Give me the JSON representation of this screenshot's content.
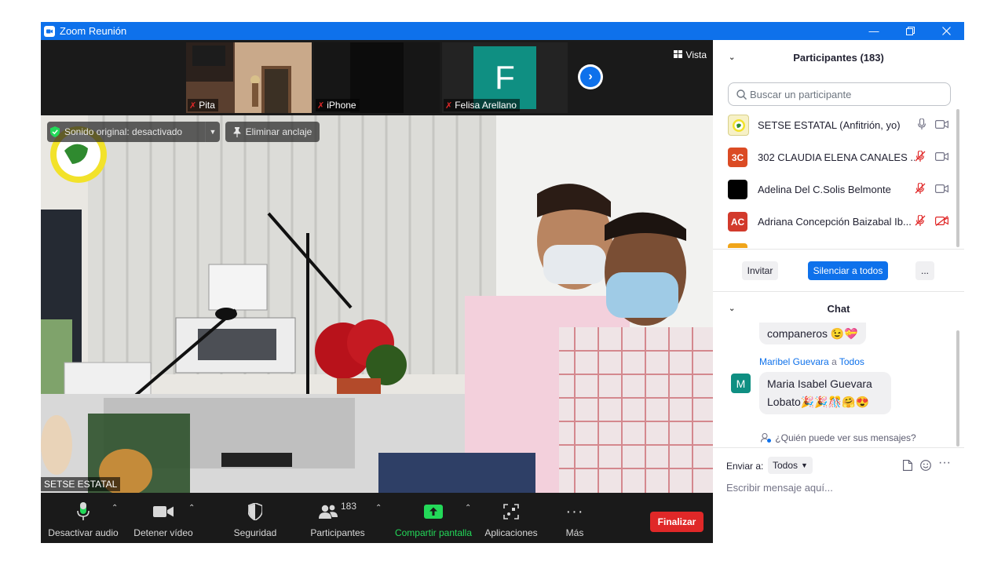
{
  "window": {
    "title": "Zoom Reunión"
  },
  "strip": {
    "tiles": [
      {
        "name": "Pita"
      },
      {
        "name": "iPhone"
      },
      {
        "name": "Felisa Arellano",
        "initial": "F"
      }
    ],
    "view_label": "Vista"
  },
  "main_video": {
    "original_sound": "Sonido original: desactivado",
    "unpin": "Eliminar anclaje",
    "speaker": "SETSE ESTATAL"
  },
  "toolbar": {
    "mute": "Desactivar audio",
    "video": "Detener vídeo",
    "security": "Seguridad",
    "participants": "Participantes",
    "participants_count": "183",
    "share": "Compartir pantalla",
    "apps": "Aplicaciones",
    "more": "Más",
    "end": "Finalizar"
  },
  "participants": {
    "title": "Participantes (183)",
    "search_placeholder": "Buscar un participante",
    "list": [
      {
        "name": "SETSE ESTATAL (Anfitrión, yo)",
        "initials": ""
      },
      {
        "name": "302 CLAUDIA ELENA CANALES ...",
        "initials": "3C"
      },
      {
        "name": "Adelina Del C.Solis Belmonte",
        "initials": ""
      },
      {
        "name": "Adriana Concepción Baizabal Ib...",
        "initials": "AC"
      }
    ],
    "invite": "Invitar",
    "mute_all": "Silenciar a todos",
    "more": "..."
  },
  "chat": {
    "title": "Chat",
    "prev_message": "companeros 😉💝",
    "sender": "Maribel Guevara",
    "to_word": "a",
    "recipient": "Todos",
    "sender_initial": "M",
    "message_line1": "Maria Isabel Guevara",
    "message_line2": "Lobato🎉🎉🎊🤗😍",
    "who_can_see": "¿Quién puede ver sus mensajes?",
    "send_to_label": "Enviar a:",
    "send_to_value": "Todos",
    "input_placeholder": "Escribir mensaje aquí..."
  },
  "colors": {
    "accent": "#0e71eb",
    "danger": "#e02828",
    "share_green": "#23d959"
  }
}
